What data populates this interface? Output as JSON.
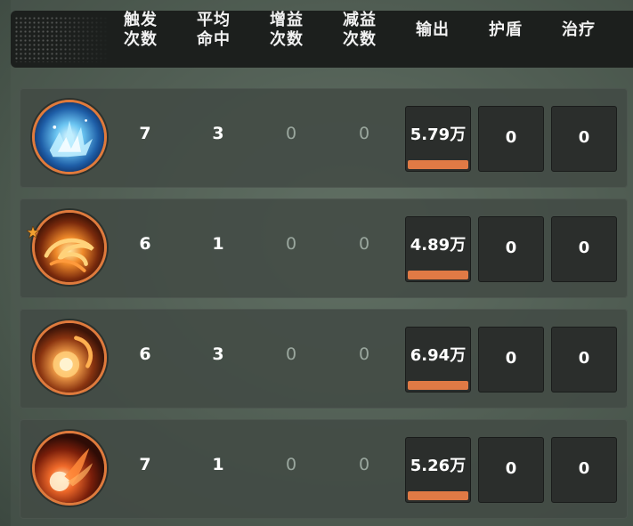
{
  "header": {
    "columns": [
      {
        "label_line1": "触发",
        "label_line2": "次数"
      },
      {
        "label_line1": "平均",
        "label_line2": "命中"
      },
      {
        "label_line1": "增益",
        "label_line2": "次数"
      },
      {
        "label_line1": "减益",
        "label_line2": "次数"
      },
      {
        "label_line1": "输出",
        "label_line2": ""
      },
      {
        "label_line1": "护盾",
        "label_line2": ""
      },
      {
        "label_line1": "治疗",
        "label_line2": ""
      }
    ]
  },
  "rows": [
    {
      "skill_icon": "ice-shard-skill-icon",
      "triggers": "7",
      "avg_hits": "3",
      "buffs": "0",
      "debuffs": "0",
      "damage": "5.79万",
      "damage_bar_fraction": 1.0,
      "shield": "0",
      "heal": "0",
      "starred": false
    },
    {
      "skill_icon": "fire-swirl-skill-icon",
      "triggers": "6",
      "avg_hits": "1",
      "buffs": "0",
      "debuffs": "0",
      "damage": "4.89万",
      "damage_bar_fraction": 1.0,
      "shield": "0",
      "heal": "0",
      "starred": true
    },
    {
      "skill_icon": "fire-orb-skill-icon",
      "triggers": "6",
      "avg_hits": "3",
      "buffs": "0",
      "debuffs": "0",
      "damage": "6.94万",
      "damage_bar_fraction": 1.0,
      "shield": "0",
      "heal": "0",
      "starred": false
    },
    {
      "skill_icon": "fireball-skill-icon",
      "triggers": "7",
      "avg_hits": "1",
      "buffs": "0",
      "debuffs": "0",
      "damage": "5.26万",
      "damage_bar_fraction": 1.0,
      "shield": "0",
      "heal": "0",
      "starred": false
    }
  ],
  "colors": {
    "accent_orange": "#e07a45",
    "header_bg": "#1c1f1d",
    "cell_bg": "#2b2e2c",
    "dim_value": "#9aa79e"
  }
}
